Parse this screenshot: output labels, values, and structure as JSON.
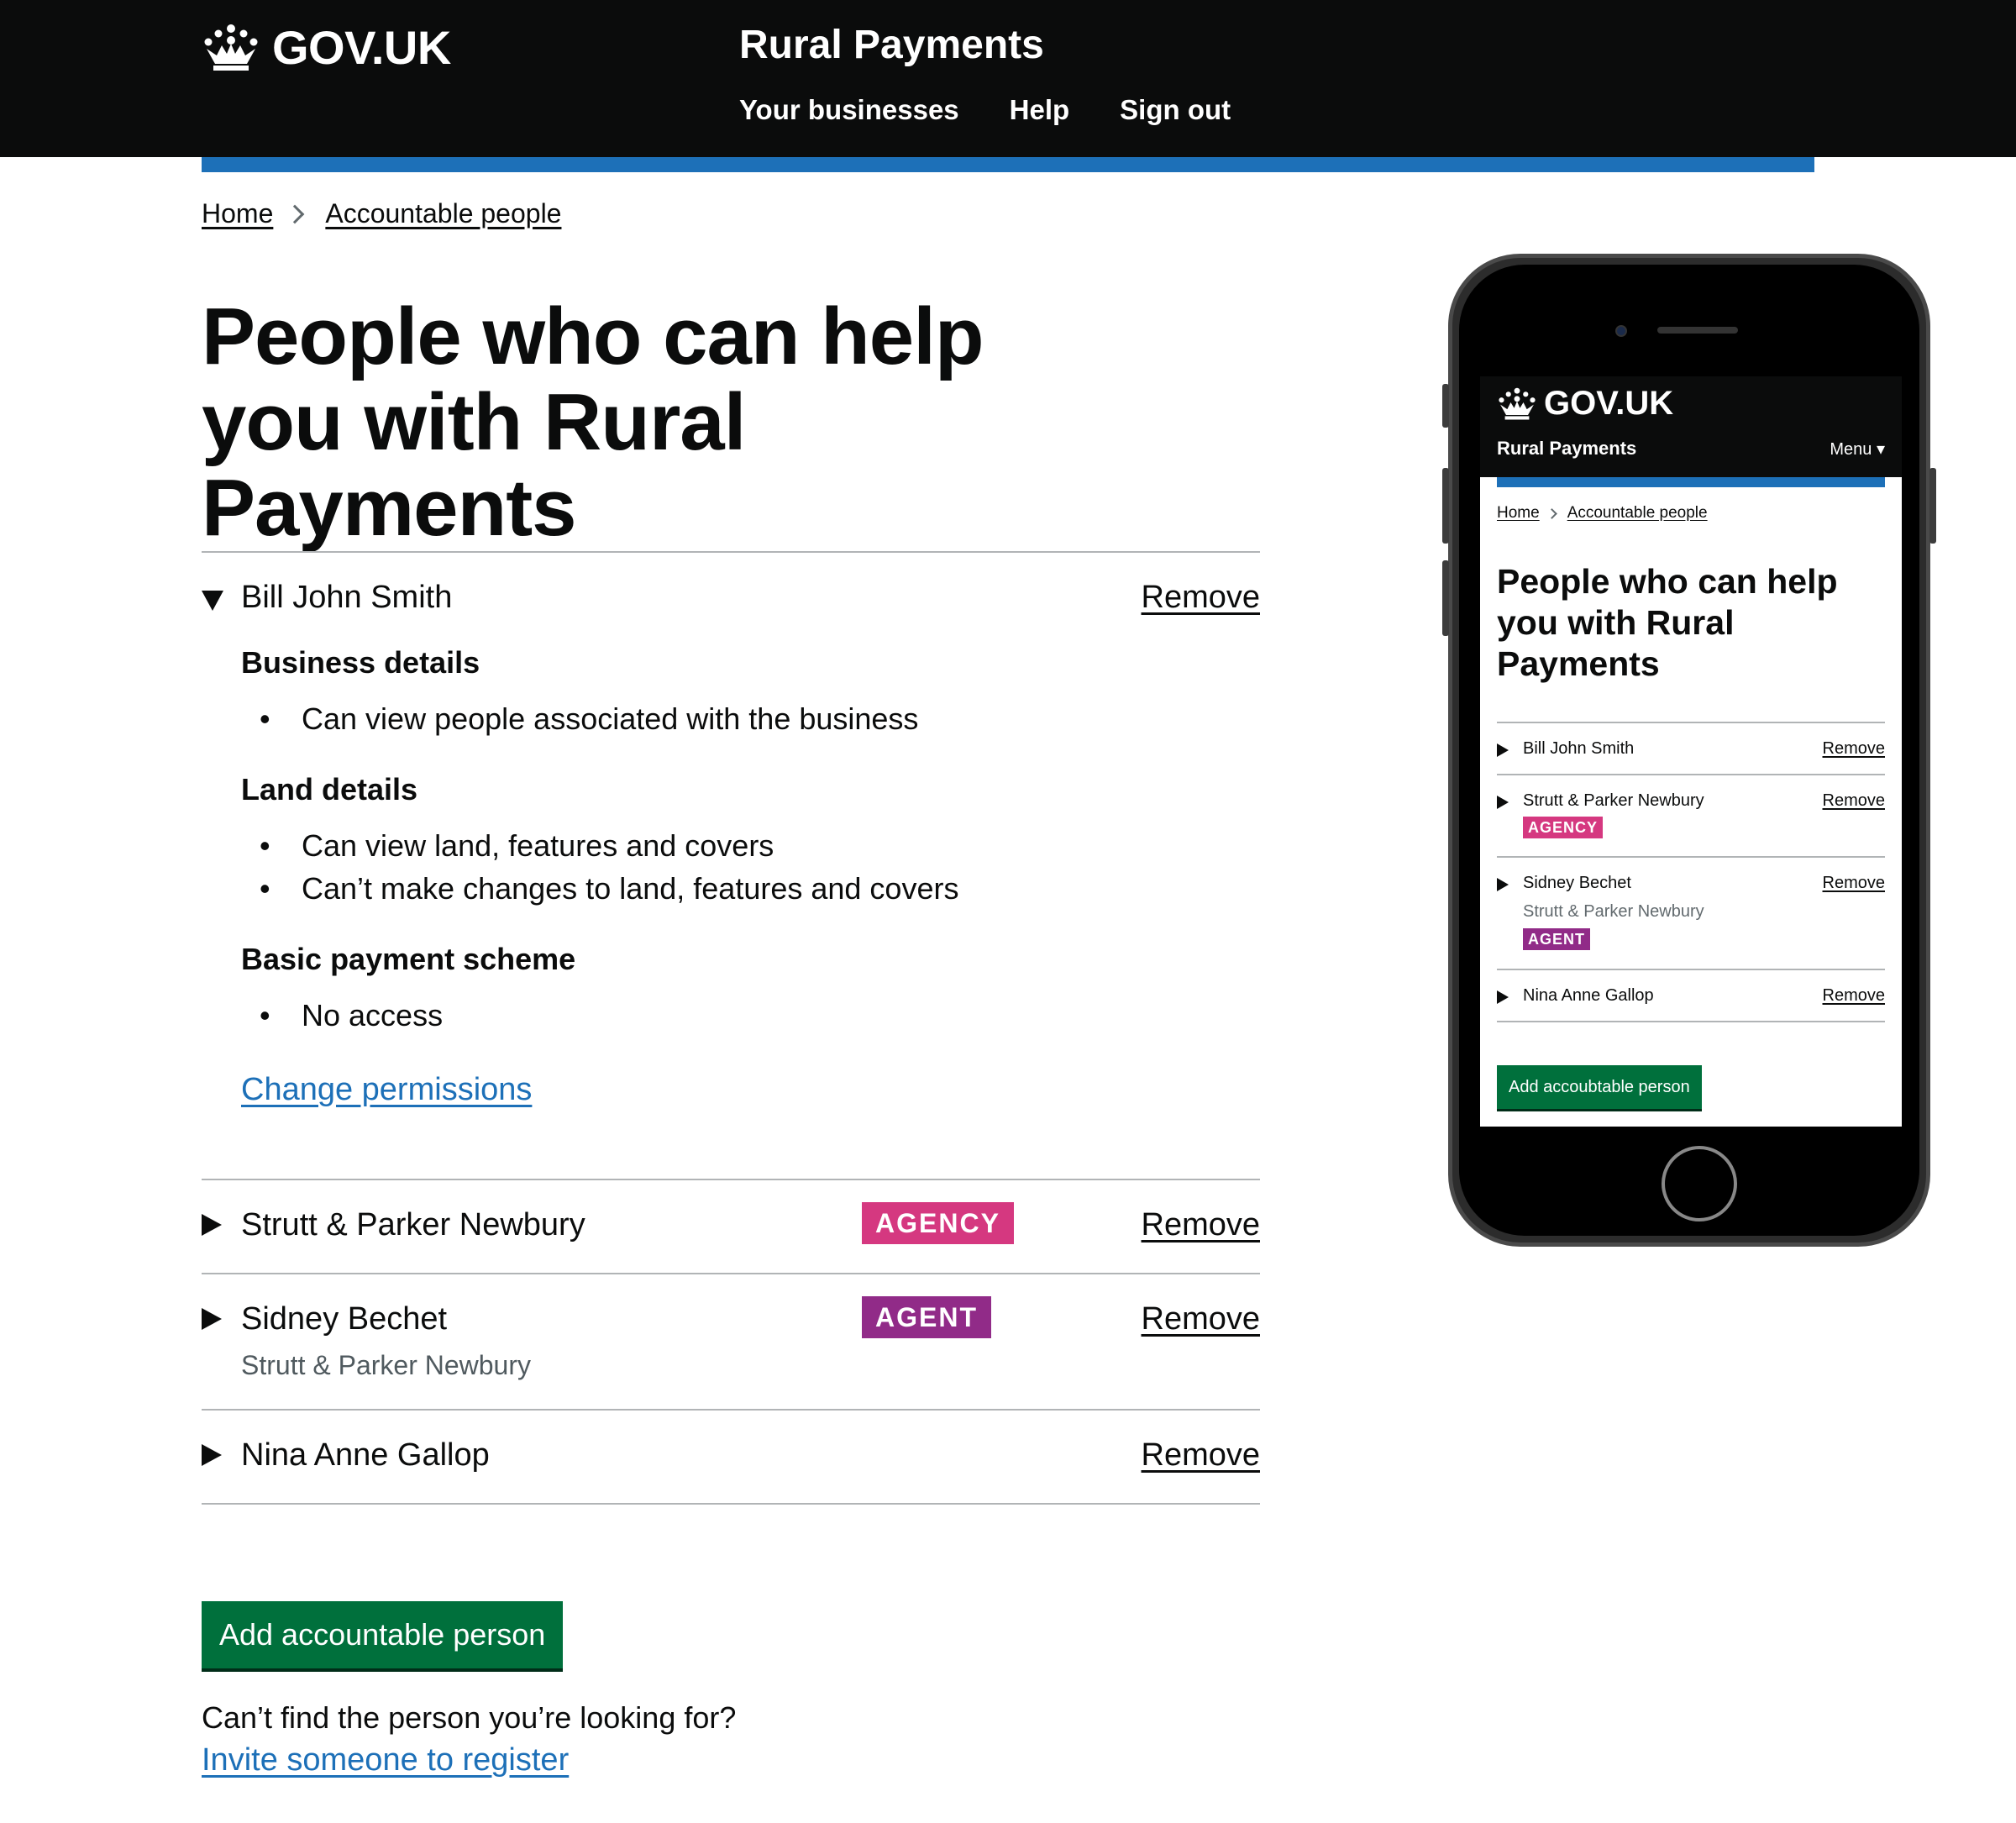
{
  "header": {
    "logo_text": "GOV.UK",
    "service_name": "Rural Payments",
    "nav": [
      "Your businesses",
      "Help",
      "Sign out"
    ]
  },
  "breadcrumb": [
    "Home",
    "Accountable people"
  ],
  "page_title": "People who can help you with Rural Payments",
  "people": [
    {
      "name": "Bill John Smith",
      "expanded": true,
      "remove_label": "Remove",
      "sections": [
        {
          "heading": "Business details",
          "items": [
            "Can view people associated with the business"
          ]
        },
        {
          "heading": "Land details",
          "items": [
            "Can view land, features and covers",
            "Can’t make changes to land, features and covers"
          ]
        },
        {
          "heading": "Basic payment scheme",
          "items": [
            "No access"
          ]
        }
      ],
      "change_link": "Change permissions"
    },
    {
      "name": "Strutt & Parker Newbury",
      "tag": "AGENCY",
      "remove_label": "Remove"
    },
    {
      "name": "Sidney Bechet",
      "sub": "Strutt & Parker Newbury",
      "tag": "AGENT",
      "remove_label": "Remove"
    },
    {
      "name": "Nina Anne Gallop",
      "remove_label": "Remove"
    }
  ],
  "add_button": "Add accountable person",
  "footer_prompt": "Can’t find the person you’re looking for?",
  "invite_link": "Invite someone to register",
  "mobile": {
    "logo_text": "GOV.UK",
    "service_name": "Rural Payments",
    "menu_label": "Menu ▾",
    "breadcrumb": [
      "Home",
      "Accountable people"
    ],
    "page_title": "People who can help you with Rural Payments",
    "people": [
      {
        "name": "Bill John Smith",
        "remove_label": "Remove"
      },
      {
        "name": "Strutt & Parker Newbury",
        "tag": "AGENCY",
        "remove_label": "Remove"
      },
      {
        "name": "Sidney Bechet",
        "sub": "Strutt & Parker Newbury",
        "tag": "AGENT",
        "remove_label": "Remove"
      },
      {
        "name": "Nina Anne Gallop",
        "remove_label": "Remove"
      }
    ],
    "add_button": "Add accoubtable person"
  },
  "colors": {
    "header_bg": "#0b0c0c",
    "brand_blue": "#1d70b8",
    "button_green": "#00703c",
    "agency_tag": "#d53880",
    "agent_tag": "#912b88",
    "border_grey": "#b1b4b6",
    "secondary_text": "#505a5f"
  },
  "icons": {
    "crown": "crown-icon",
    "breadcrumb_separator": "chevron-right-icon",
    "expanded": "triangle-down-icon",
    "collapsed": "triangle-right-icon"
  }
}
